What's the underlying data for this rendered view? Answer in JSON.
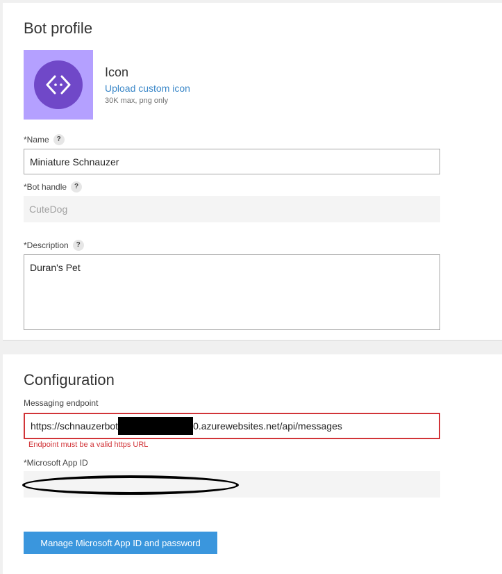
{
  "bot_profile": {
    "title": "Bot profile",
    "icon": {
      "heading": "Icon",
      "upload_link": "Upload custom icon",
      "hint": "30K max, png only",
      "glyph": "code-brackets-icon",
      "tile_color": "#b4a0ff",
      "circle_color": "#7048c8"
    },
    "name": {
      "label": "*Name",
      "help": "?",
      "value": "Miniature Schnauzer"
    },
    "handle": {
      "label": "*Bot handle",
      "help": "?",
      "value": "CuteDog"
    },
    "description": {
      "label": "*Description",
      "help": "?",
      "value": "Duran's Pet"
    }
  },
  "configuration": {
    "title": "Configuration",
    "endpoint": {
      "label": "Messaging endpoint",
      "value_prefix": "https://schnauzerbot",
      "value_suffix": "0.azurewebsites.net/api/messages",
      "error": "Endpoint must be a valid https URL",
      "error_color": "#d13438"
    },
    "app_id": {
      "label": "*Microsoft App ID"
    },
    "manage_button": "Manage Microsoft App ID and password",
    "button_color": "#3a96dd"
  }
}
